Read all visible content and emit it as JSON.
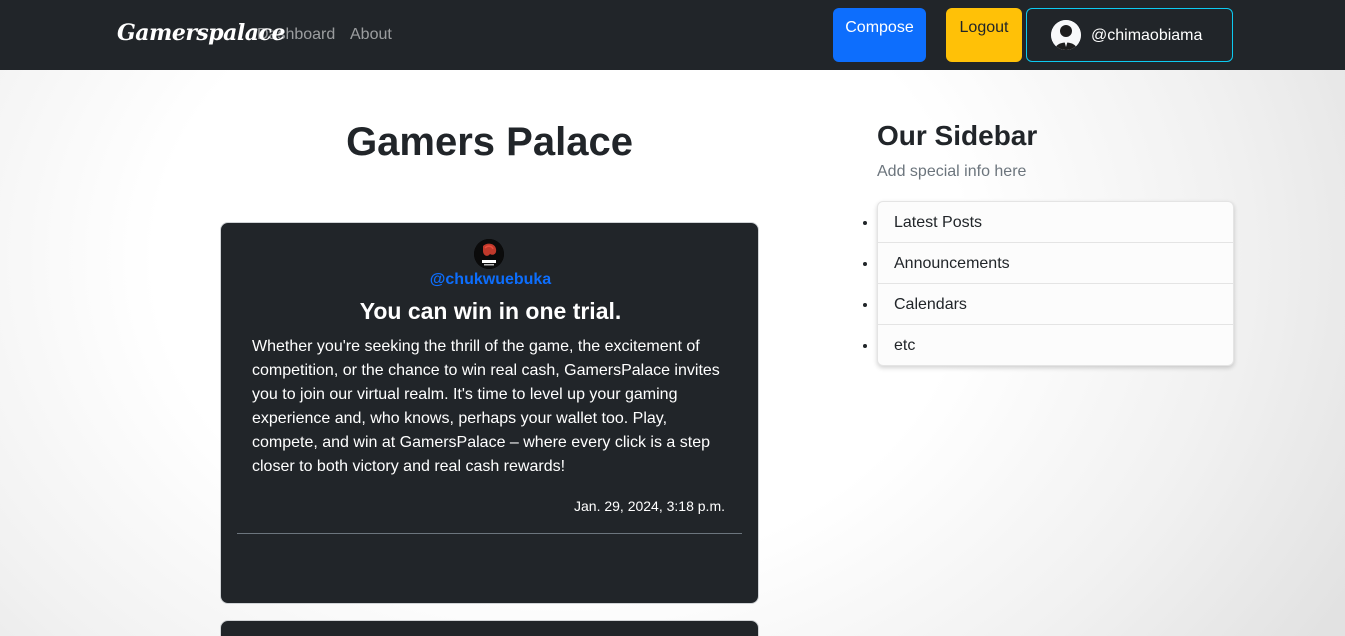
{
  "navbar": {
    "brand": "Gamerspalace",
    "links": [
      "Dashboard",
      "About"
    ],
    "compose_label": "Compose",
    "logout_label": "Logout",
    "username": "@chimaobiama"
  },
  "main": {
    "page_title": "Gamers Palace",
    "posts": [
      {
        "author": "@chukwuebuka",
        "title": "You can win in one trial.",
        "body": "Whether you're seeking the thrill of the game, the excitement of competition, or the chance to win real cash, GamersPalace invites you to join our virtual realm. It's time to level up your gaming experience and, who knows, perhaps your wallet too. Play, compete, and win at GamersPalace – where every click is a step closer to both victory and real cash rewards!",
        "date": "Jan. 29, 2024, 3:18 p.m."
      }
    ]
  },
  "sidebar": {
    "title": "Our Sidebar",
    "subtitle": "Add special info here",
    "items": [
      "Latest Posts",
      "Announcements",
      "Calendars",
      "etc"
    ]
  },
  "colors": {
    "navbar_bg": "#212529",
    "compose": "#0d6efd",
    "logout": "#ffc107",
    "user_border": "#0dcaf0",
    "card_bg": "#212529",
    "author_link": "#0d6efd"
  },
  "icons": {
    "user_avatar": "person-silhouette-icon",
    "post_avatar": "gamer-logo-icon"
  }
}
